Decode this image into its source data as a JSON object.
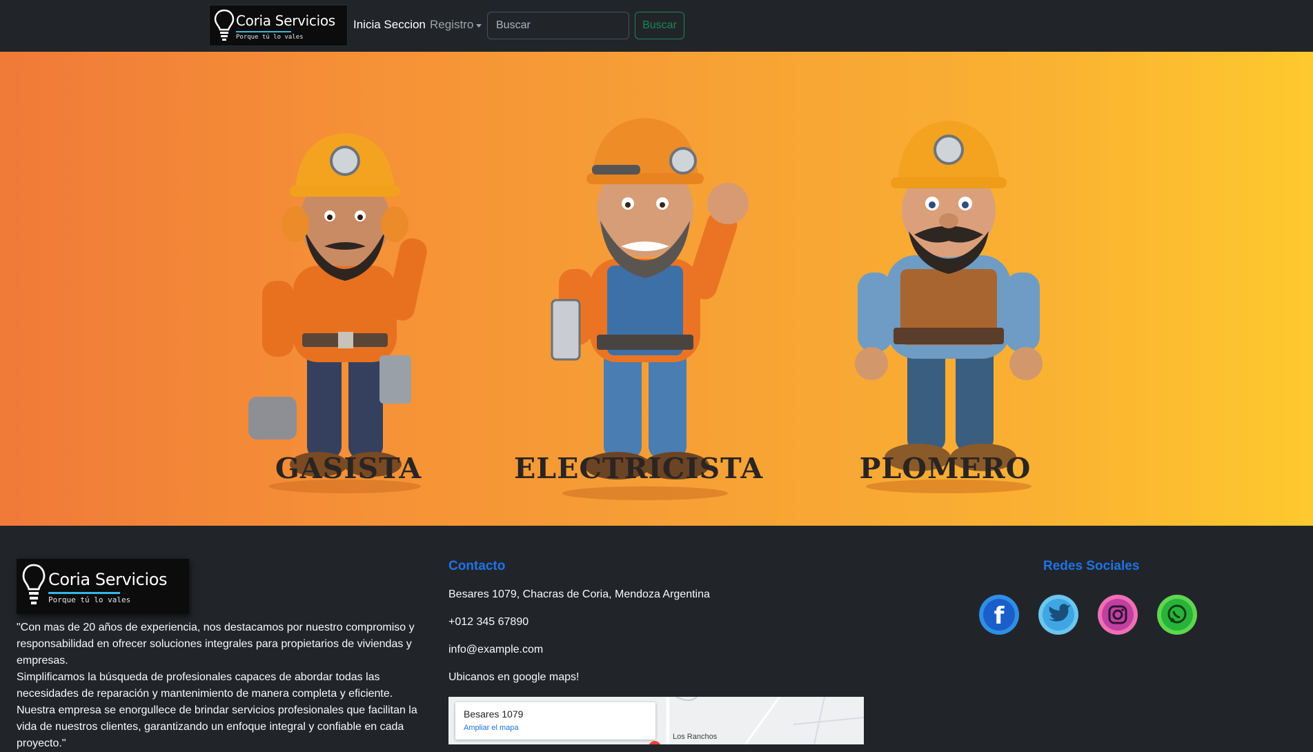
{
  "brand": {
    "name": "Coria Servicios",
    "tagline": "Porque tú lo vales",
    "accent": "#38b6e8"
  },
  "nav": {
    "login_label": "Inicia Seccion",
    "register_label": "Registro",
    "search_placeholder": "Buscar",
    "search_button": "Buscar"
  },
  "hero": {
    "gradient_start": "#f07a38",
    "gradient_end": "#fec92e",
    "workers": [
      {
        "label": "GASISTA",
        "icon": "gas-worker-illustration"
      },
      {
        "label": "ELECTRICISTA",
        "icon": "electrician-worker-illustration"
      },
      {
        "label": "PLOMERO",
        "icon": "plumber-worker-illustration"
      }
    ]
  },
  "footer": {
    "about": {
      "p1": "\"Con mas de 20 años de experiencia, nos destacamos por nuestro compromiso y responsabilidad en ofrecer soluciones integrales para propietarios de viviendas y empresas.",
      "p2": "Simplificamos la búsqueda de profesionales capaces de abordar todas las necesidades de reparación y mantenimiento de manera completa y eficiente.",
      "p3": "Nuestra empresa se enorgullece de brindar servicios profesionales que facilitan la vida de nuestros clientes, garantizando un enfoque integral y confiable en cada proyecto.\""
    },
    "contact": {
      "title": "Contacto",
      "address": "Besares 1079, Chacras de Coria, Mendoza Argentina",
      "phone": "+012 345 67890",
      "email": "info@example.com",
      "maps_text": "Ubicanos en google maps!"
    },
    "map": {
      "place_title": "Besares 1079",
      "enlarge_link": "Ampliar el mapa",
      "nearby_label": "Los Ranchos"
    },
    "social": {
      "title": "Redes Sociales",
      "icons": [
        "facebook-icon",
        "twitter-icon",
        "instagram-icon",
        "whatsapp-icon"
      ]
    },
    "title_color": "#1e73e8"
  }
}
